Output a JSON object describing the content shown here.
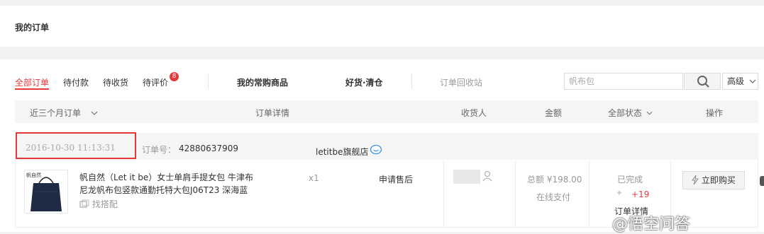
{
  "page": {
    "title": "我的订单"
  },
  "tabs": [
    {
      "label": "全部订单",
      "active": true
    },
    {
      "label": "待付款"
    },
    {
      "label": "待收货"
    },
    {
      "label": "待评价",
      "badge": "8"
    }
  ],
  "links": {
    "frequent": "我的常购商品",
    "clearance": "好货·清仓",
    "recycle": "订单回收站"
  },
  "search": {
    "placeholder": "帆布包",
    "advanced_label": "高级"
  },
  "table_header": {
    "period": "近三个月订单",
    "details": "订单详情",
    "receiver": "收货人",
    "amount": "金额",
    "status": "全部状态",
    "actions": "操作"
  },
  "order": {
    "date": "2016-10-30 11:13:31",
    "number_label": "订单号：",
    "number": "42880637909",
    "shop": "letitbe旗舰店",
    "product_title": "帆自然（Let it be）女士单肩手提女包 牛津布尼龙帆布包竖款通勤托特大包J06T23 深海蓝",
    "find_match": "找搭配",
    "brand_text": "帆自然",
    "quantity": "x1",
    "after_sale": "申请售后",
    "total": "总额 ¥198.00",
    "payment": "在线支付",
    "status": "已完成",
    "points": "+19",
    "order_detail": "订单详情",
    "buy_again": "立即购买"
  },
  "watermark": "@悟空问答",
  "colors": {
    "accent": "#e4393c",
    "header_bg": "#f5f5f5",
    "page_bg": "#f2f2f2"
  }
}
